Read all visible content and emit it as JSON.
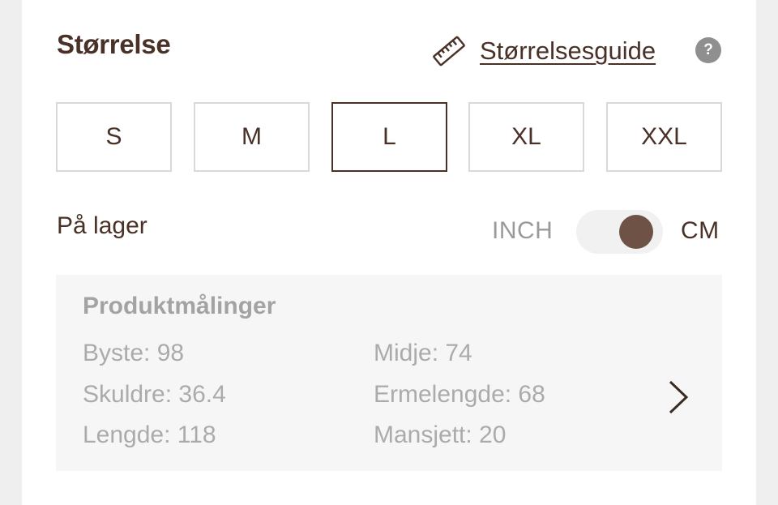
{
  "section_title": "Størrelse",
  "size_guide": {
    "label": "Størrelsesguide",
    "help_symbol": "?"
  },
  "sizes": [
    {
      "label": "S",
      "selected": false
    },
    {
      "label": "M",
      "selected": false
    },
    {
      "label": "L",
      "selected": true
    },
    {
      "label": "XL",
      "selected": false
    },
    {
      "label": "XXL",
      "selected": false
    }
  ],
  "stock_status": "På lager",
  "unit_toggle": {
    "left_label": "INCH",
    "right_label": "CM",
    "active": "CM"
  },
  "measurements": {
    "title": "Produktmålinger",
    "items": [
      "Byste: 98",
      "Midje: 74",
      "Skuldre: 36.4",
      "Ermelengde: 68",
      "Lengde: 118",
      "Mansjett: 20"
    ]
  },
  "colors": {
    "brand_brown": "#4a3128",
    "toggle_knob": "#6e5246",
    "muted_text": "#ababab"
  },
  "icons": [
    "ruler-icon",
    "help-icon",
    "chevron-right-icon"
  ]
}
